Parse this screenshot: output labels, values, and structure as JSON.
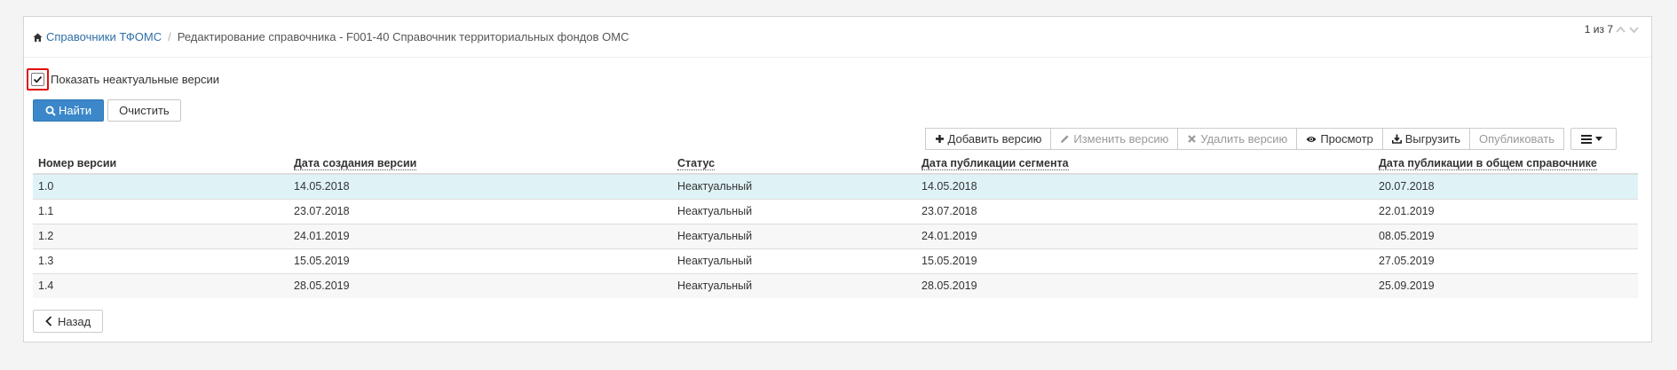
{
  "breadcrumb": {
    "home_icon": "home-icon",
    "link": "Справочники ТФОМС",
    "separator": "/",
    "current": "Редактирование справочника - F001-40 Справочник территориальных фондов ОМС"
  },
  "pager": {
    "label": "1 из 7",
    "up_icon": "chevron-up-icon",
    "down_icon": "chevron-down-icon"
  },
  "filter": {
    "show_outdated_label": "Показать неактуальные версии",
    "show_outdated_checked": true
  },
  "buttons": {
    "find": "Найти",
    "clear": "Очистить",
    "back": "Назад"
  },
  "toolbar": {
    "add": "Добавить версию",
    "edit": "Изменить версию",
    "delete": "Удалить версию",
    "view": "Просмотр",
    "export": "Выгрузить",
    "publish": "Опубликовать",
    "menu_icon": "hamburger-icon"
  },
  "table": {
    "columns": [
      "Номер версии",
      "Дата создания версии",
      "Статус",
      "Дата публикации сегмента",
      "Дата публикации в общем справочнике"
    ],
    "rows": [
      [
        "1.0",
        "14.05.2018",
        "Неактуальный",
        "14.05.2018",
        "20.07.2018"
      ],
      [
        "1.1",
        "23.07.2018",
        "Неактуальный",
        "23.07.2018",
        "22.01.2019"
      ],
      [
        "1.2",
        "24.01.2019",
        "Неактуальный",
        "24.01.2019",
        "08.05.2019"
      ],
      [
        "1.3",
        "15.05.2019",
        "Неактуальный",
        "15.05.2019",
        "27.05.2019"
      ],
      [
        "1.4",
        "28.05.2019",
        "Неактуальный",
        "28.05.2019",
        "25.09.2019"
      ]
    ],
    "selected_row": 0
  },
  "colors": {
    "primary": "#3b87c9",
    "link": "#2f6fa7",
    "selected_row": "#dff3f7",
    "highlight_border": "#e01010"
  }
}
